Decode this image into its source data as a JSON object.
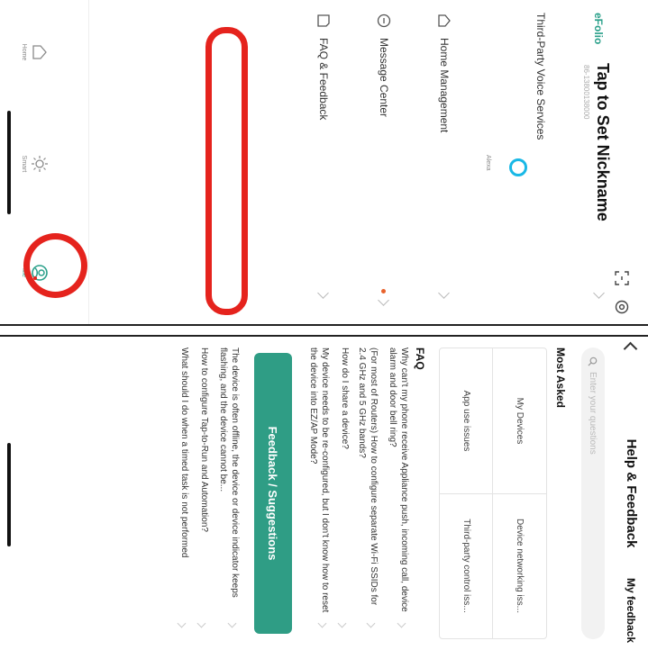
{
  "profile": {
    "brand": "eFolio",
    "nickname": "Tap to Set Nickname",
    "account_id": "86-13800138000",
    "voice_services_label": "Third-Party Voice Services",
    "alexa_label": "Alexa"
  },
  "menu": {
    "items": [
      {
        "label": "Home Management",
        "icon": "house-outline-icon"
      },
      {
        "label": "Message Center",
        "icon": "alert-circle-icon",
        "has_badge": true
      },
      {
        "label": "FAQ & Feedback",
        "icon": "document-icon"
      }
    ]
  },
  "tabbar": {
    "home": "Home",
    "smart": "Smart",
    "me": "Me"
  },
  "colors": {
    "brand_green": "#2aa08a",
    "highlight_red": "#e5231d",
    "alexa_blue": "#19b8e6",
    "button_green": "#2f9d85"
  },
  "help": {
    "title": "Help & Feedback",
    "my_feedback": "My feedback",
    "search_placeholder": "Enter your questions",
    "most_asked_title": "Most Asked",
    "categories": [
      "My Devices",
      "Device networking iss...",
      "App use issues",
      "Third-party control iss..."
    ],
    "faq_title": "FAQ",
    "faq": [
      "Why can't my phone receive Appliance push, incoming call, device alarm and door bell ring?",
      "(For most of Routers) How to configure separate Wi-Fi SSIDs for 2.4 GHz and 5 GHz bands?",
      "How do I share a device?",
      "My device needs to be re-configured, but I don't know how to reset the device into EZ/AP Mode?",
      "The device is often offline, the device or device indicator keeps flashing, and the device cannot be...",
      "How to configure Tap-to-Run and Automation?",
      "What should I do when a timed task is not performed"
    ],
    "feedback_button": "Feedback / Suggestions"
  }
}
